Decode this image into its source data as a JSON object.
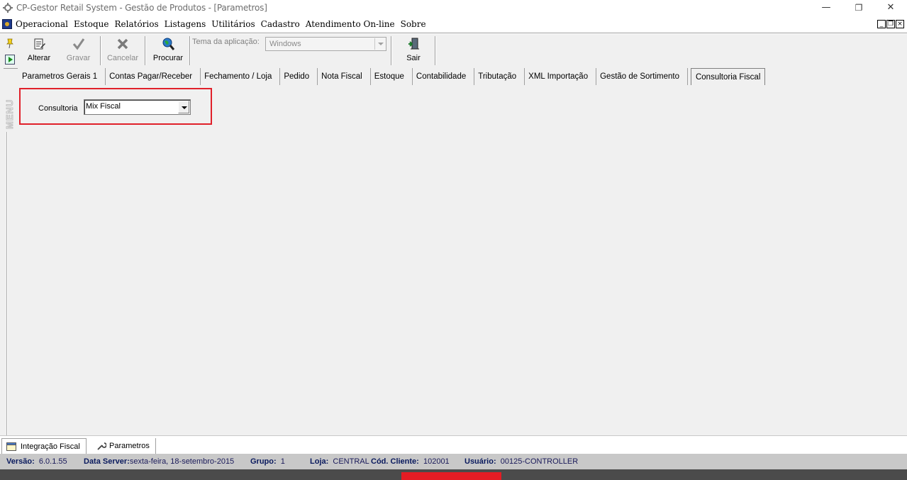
{
  "window": {
    "title": "CP-Gestor Retail System - Gestão de Produtos - [Parametros]",
    "minimize_glyph": "—",
    "maximize_glyph": "❐",
    "close_glyph": "✕"
  },
  "menubar": {
    "items": [
      "Operacional",
      "Estoque",
      "Relatórios",
      "Listagens",
      "Utilitários",
      "Cadastro",
      "Atendimento On-line",
      "Sobre"
    ],
    "mdi_buttons": [
      "_",
      "❐",
      "×"
    ]
  },
  "leftstrip": {
    "menu_label": "MENU",
    "icons": [
      "pin-icon",
      "go-icon"
    ]
  },
  "toolbar": {
    "alterar": "Alterar",
    "gravar": "Gravar",
    "cancelar": "Cancelar",
    "procurar": "Procurar",
    "sair": "Sair",
    "theme_label": "Tema da aplicação:",
    "theme_value": "Windows"
  },
  "tabs": [
    "Parametros Gerais 1",
    "Contas Pagar/Receber",
    "Fechamento / Loja",
    "Pedido",
    "Nota Fiscal",
    "Estoque",
    "Contabilidade",
    "Tributação",
    "XML Importação",
    "Gestão de Sortimento",
    "Consultoria Fiscal"
  ],
  "active_tab": "Consultoria Fiscal",
  "content": {
    "consultoria_label": "Consultoria",
    "consultoria_value": "Mix Fiscal"
  },
  "taskbar": {
    "tab1": "Integração Fiscal",
    "tab2": "Parametros"
  },
  "statusbar": {
    "versao_label": "Versão:",
    "versao_value": "6.0.1.55",
    "data_server_label": "Data Server:",
    "data_server_value": "sexta-feira, 18-setembro-2015",
    "grupo_label": "Grupo:",
    "grupo_value": "1",
    "loja_label": "Loja:",
    "loja_value": "CENTRAL",
    "cod_cliente_label": "Cód. Cliente:",
    "cod_cliente_value": "102001",
    "usuario_label": "Usuário:",
    "usuario_value": "00125-CONTROLLER"
  },
  "colors": {
    "highlight_box": "#e0202a",
    "bottom_bar_accent": "#e41c24",
    "status_text": "#0a1a5e"
  }
}
